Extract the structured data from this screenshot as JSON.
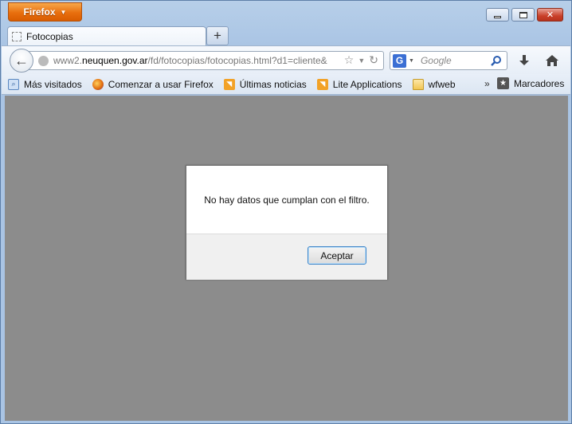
{
  "browser": {
    "menu_button_label": "Firefox",
    "window_controls": {
      "minimize_icon": "minimize-icon",
      "maximize_icon": "restore-icon",
      "close_icon": "close-icon",
      "close_label": "✕"
    },
    "tab": {
      "title": "Fotocopias",
      "new_tab_label": "+"
    },
    "url": {
      "prefix": "www2.",
      "host": "neuquen.gov.ar",
      "path": "/fd/fotocopias/fotocopias.html?d1=cliente&"
    },
    "search": {
      "engine": "G",
      "placeholder": "Google"
    },
    "bookmarks": [
      {
        "label": "Más visitados",
        "icon": "most-visited-icon"
      },
      {
        "label": "Comenzar a usar Firefox",
        "icon": "firefox-icon"
      },
      {
        "label": "Últimas noticias",
        "icon": "rss-icon"
      },
      {
        "label": "Lite Applications",
        "icon": "rss-icon"
      },
      {
        "label": "wfweb",
        "icon": "folder-icon"
      }
    ],
    "bookmarks_overflow": "»",
    "bookmarks_menu_label": "Marcadores"
  },
  "dialog": {
    "message": "No hay datos que cumplan con el filtro.",
    "ok_label": "Aceptar"
  },
  "colors": {
    "accent": "#e86f0e",
    "page_overlay": "#8c8c8c",
    "dialog_footer": "#f0f0f0"
  }
}
